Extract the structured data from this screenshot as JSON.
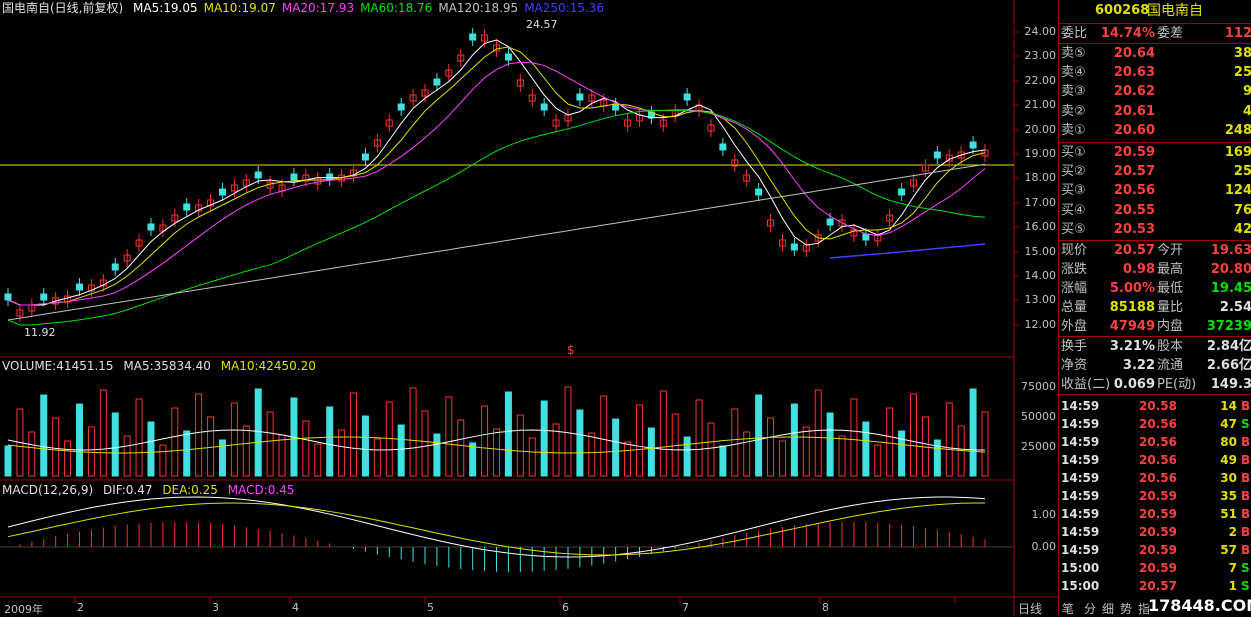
{
  "window": {
    "title": "国电南自(日线,前复权)"
  },
  "main_indicators": [
    {
      "label": "MA5:19.05",
      "color": "#ffffff"
    },
    {
      "label": "MA10:19.07",
      "color": "#e0e000"
    },
    {
      "label": "MA20:17.93",
      "color": "#ff40ff"
    },
    {
      "label": "MA60:18.76",
      "color": "#00e000"
    },
    {
      "label": "MA120:18.95",
      "color": "#c0c0c0"
    },
    {
      "label": "MA250:15.36",
      "color": "#4040ff"
    }
  ],
  "price_axis": [
    "24.00",
    "23.00",
    "22.00",
    "21.00",
    "20.00",
    "19.00",
    "18.00",
    "17.00",
    "16.00",
    "15.00",
    "14.00",
    "13.00",
    "12.00"
  ],
  "annotations": {
    "high": "24.57",
    "low": "11.92",
    "marker": "$"
  },
  "volume": {
    "header": "VOLUME:41451.15",
    "ma5": "MA5:35834.40",
    "ma10": "MA10:42450.20",
    "axis": [
      "75000",
      "50000",
      "25000"
    ]
  },
  "macd": {
    "header": "MACD(12,26,9)",
    "dif": "DIF:0.47",
    "dea": "DEA:0.25",
    "macd": "MACD:0.45",
    "axis": [
      "1.00",
      "0.00"
    ]
  },
  "dates": [
    "2009年",
    "2",
    "3",
    "4",
    "5",
    "6",
    "7",
    "8"
  ],
  "quote": {
    "code": "600268",
    "name": "国电南自",
    "weibi": {
      "label": "委比",
      "value": "14.74%",
      "label2": "委差",
      "value2": "112"
    },
    "asks": [
      {
        "label": "卖⑤",
        "price": "20.64",
        "vol": "38"
      },
      {
        "label": "卖④",
        "price": "20.63",
        "vol": "25"
      },
      {
        "label": "卖③",
        "price": "20.62",
        "vol": "9"
      },
      {
        "label": "卖②",
        "price": "20.61",
        "vol": "4"
      },
      {
        "label": "卖①",
        "price": "20.60",
        "vol": "248"
      }
    ],
    "bids": [
      {
        "label": "买①",
        "price": "20.59",
        "vol": "169"
      },
      {
        "label": "买②",
        "price": "20.57",
        "vol": "25"
      },
      {
        "label": "买③",
        "price": "20.56",
        "vol": "124"
      },
      {
        "label": "买④",
        "price": "20.55",
        "vol": "76"
      },
      {
        "label": "买⑤",
        "price": "20.53",
        "vol": "42"
      }
    ],
    "stats": [
      {
        "k": "现价",
        "v": "20.57",
        "vc": "red",
        "k2": "今开",
        "v2": "19.63",
        "v2c": "red"
      },
      {
        "k": "涨跌",
        "v": "0.98",
        "vc": "red",
        "k2": "最高",
        "v2": "20.80",
        "v2c": "red"
      },
      {
        "k": "涨幅",
        "v": "5.00%",
        "vc": "red",
        "k2": "最低",
        "v2": "19.45",
        "v2c": "grn"
      },
      {
        "k": "总量",
        "v": "85188",
        "vc": "yel",
        "k2": "量比",
        "v2": "2.54",
        "v2c": "wht"
      },
      {
        "k": "外盘",
        "v": "47949",
        "vc": "red",
        "k2": "内盘",
        "v2": "37239",
        "v2c": "grn"
      }
    ],
    "stats2": [
      {
        "k": "换手",
        "v": "3.21%",
        "k2": "股本",
        "v2": "2.84亿"
      },
      {
        "k": "净资",
        "v": "3.22",
        "k2": "流通",
        "v2": "2.66亿"
      },
      {
        "k": "收益(二)",
        "v": "0.069",
        "k2": "PE(动)",
        "v2": "149.3"
      }
    ],
    "ticks": [
      {
        "t": "14:59",
        "p": "20.58",
        "q": "14",
        "s": "B"
      },
      {
        "t": "14:59",
        "p": "20.56",
        "q": "47",
        "s": "S"
      },
      {
        "t": "14:59",
        "p": "20.56",
        "q": "80",
        "s": "B"
      },
      {
        "t": "14:59",
        "p": "20.56",
        "q": "49",
        "s": "B"
      },
      {
        "t": "14:59",
        "p": "20.56",
        "q": "30",
        "s": "B"
      },
      {
        "t": "14:59",
        "p": "20.59",
        "q": "35",
        "s": "B"
      },
      {
        "t": "14:59",
        "p": "20.59",
        "q": "51",
        "s": "B"
      },
      {
        "t": "14:59",
        "p": "20.59",
        "q": "2",
        "s": "B"
      },
      {
        "t": "14:59",
        "p": "20.59",
        "q": "57",
        "s": "B"
      },
      {
        "t": "15:00",
        "p": "20.59",
        "q": "7",
        "s": "S"
      },
      {
        "t": "15:00",
        "p": "20.57",
        "q": "1",
        "s": "S"
      }
    ]
  },
  "tabs": [
    "日线",
    "笔",
    "分",
    "细",
    "势",
    "指"
  ],
  "watermark": "178448.COM"
}
